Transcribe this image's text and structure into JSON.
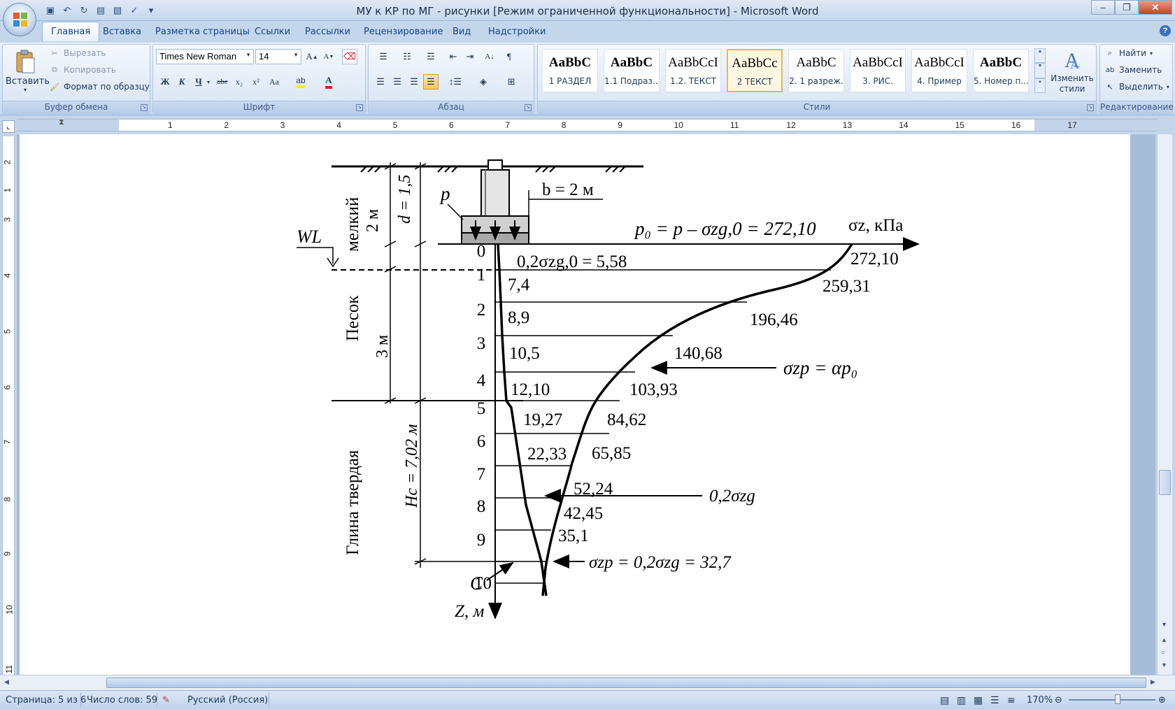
{
  "window": {
    "title": "МУ к КР по МГ - рисунки [Режим ограниченной функциональности] - Microsoft Word",
    "minimize": "–",
    "maximize": "❐",
    "close": "✕"
  },
  "tabs": [
    "Главная",
    "Вставка",
    "Разметка страницы",
    "Ссылки",
    "Рассылки",
    "Рецензирование",
    "Вид",
    "Надстройки"
  ],
  "active_tab": "Главная",
  "clipboard": {
    "paste": "Вставить",
    "cut": "Вырезать",
    "copy": "Копировать",
    "format_painter": "Формат по образцу",
    "label": "Буфер обмена"
  },
  "font": {
    "name": "Times New Roman",
    "size": "14",
    "label": "Шрифт",
    "bold": "Ж",
    "italic": "К",
    "underline": "Ч",
    "strike": "abe",
    "subscript": "x₂",
    "superscript": "x²",
    "case": "Aa"
  },
  "paragraph": {
    "label": "Абзац"
  },
  "styles": {
    "label": "Стили",
    "items": [
      {
        "sample": "AaBbC",
        "name": "1 РАЗДЕЛ",
        "bold": true
      },
      {
        "sample": "AaBbC",
        "name": "1.1 Подраз...",
        "bold": true
      },
      {
        "sample": "AaBbCcI",
        "name": "1.2. ТЕКСТ",
        "bold": false
      },
      {
        "sample": "AaBbCc",
        "name": "2 ТЕКСТ",
        "bold": false
      },
      {
        "sample": "AaBbC",
        "name": "2. 1 разреж.",
        "bold": false
      },
      {
        "sample": "AaBbCcI",
        "name": "3. РИС.",
        "bold": false
      },
      {
        "sample": "AaBbCcI",
        "name": "4. Пример",
        "bold": false
      },
      {
        "sample": "AaBbC",
        "name": "5. Номер п...",
        "bold": true
      }
    ],
    "selected_index": 3,
    "change_styles": "Изменить стили"
  },
  "editing": {
    "label": "Редактирование",
    "find": "Найти",
    "replace": "Заменить",
    "select": "Выделить"
  },
  "ruler": {
    "h_numbers": [
      "1",
      "2",
      "3",
      "4",
      "5",
      "6",
      "7",
      "8",
      "9",
      "10",
      "11",
      "12",
      "13",
      "14",
      "15",
      "16",
      "17"
    ],
    "v_numbers": [
      "2",
      "1",
      "3",
      "4",
      "5",
      "6",
      "7",
      "8",
      "9",
      "10",
      "11"
    ]
  },
  "diagram": {
    "top_label": "p₀ = p – σzg,0 = 272,10",
    "axis_label": "σz, кПа",
    "b_label": "b = 2 м",
    "d_label": "d = 1,5",
    "p_label": "p",
    "wl_label": "WL",
    "layer1": "мелкий",
    "layer1_thick": "2 м",
    "layer2": "Песок",
    "layer2_thick": "3 м",
    "layer3": "Глина твердая",
    "hc_label": "Hc = 7,02 м",
    "c_label": "C",
    "z_label": "Z, м",
    "sigma_zp_label": "σzp = αp₀",
    "sigma_zg_label": "0,2σzg",
    "bottom_label": "σzp = 0,2σzg = 32,7",
    "first_zg": "0,2σzg,0 = 5,58",
    "depth_indices": [
      "0",
      "1",
      "2",
      "3",
      "4",
      "5",
      "6",
      "7",
      "8",
      "9",
      "10"
    ],
    "zg_values": [
      "7,4",
      "8,9",
      "10,5",
      "12,10",
      "19,27",
      "22,33"
    ],
    "zp_values": [
      "272,10",
      "259,31",
      "196,46",
      "140,68",
      "103,93",
      "84,62",
      "65,85",
      "52,24",
      "42,45",
      "35,1"
    ]
  },
  "status": {
    "page": "Страница: 5 из 6",
    "words": "Число слов: 59",
    "language": "Русский (Россия)",
    "zoom": "170%"
  }
}
